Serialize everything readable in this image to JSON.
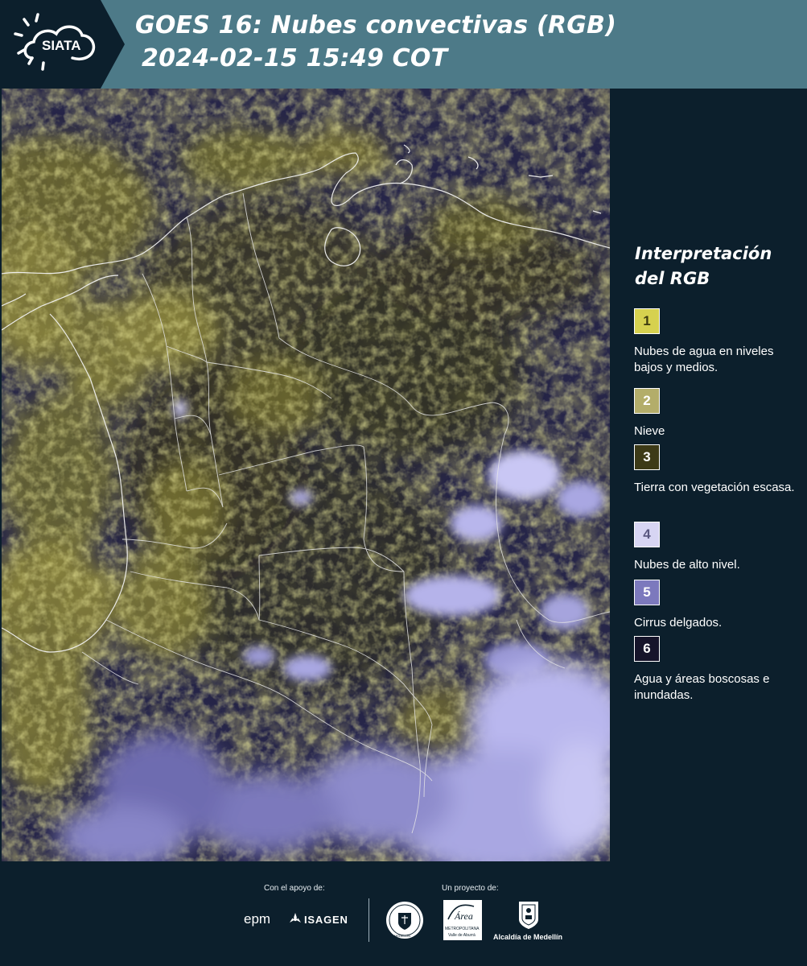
{
  "header": {
    "logo_text": "SIATA",
    "title_line1": "GOES 16: Nubes convectivas (RGB)",
    "title_line2": "2024-02-15 15:49 COT"
  },
  "legend": {
    "title": "Interpretación del RGB",
    "items": [
      {
        "number": "1",
        "label": "Nubes de agua en niveles bajos y medios.",
        "color": "#d6d14f",
        "number_color": "#3c3a10"
      },
      {
        "number": "2",
        "label": "Nieve",
        "color": "#b3ad6a",
        "number_color": "#ffffff"
      },
      {
        "number": "3",
        "label": "Tierra con vegetación escasa.",
        "color": "#3d3a17",
        "number_color": "#ffffff"
      },
      {
        "number": "4",
        "label": "Nubes de alto nivel.",
        "color": "#d7d5f3",
        "number_color": "#5a5880"
      },
      {
        "number": "5",
        "label": "Cirrus delgados.",
        "color": "#7c79bd",
        "number_color": "#ffffff"
      },
      {
        "number": "6",
        "label": "Agua y áreas boscosas e inundadas.",
        "color": "#16142a",
        "number_color": "#ffffff"
      }
    ]
  },
  "footer": {
    "support_label": "Con el apoyo de:",
    "project_label": "Un proyecto de:",
    "sponsor_epm": "epm",
    "sponsor_isagen": "ISAGEN",
    "area_metropolitana": "Área",
    "area_sub1": "METROPOLITANA",
    "area_sub2": "Valle de Aburrá",
    "alcaldia": "Alcaldía de Medellín",
    "seal_text": "MEDELLÍN"
  },
  "colors": {
    "header_bg": "#4d7a88",
    "page_bg": "#0c1f2c",
    "low_cloud_yellow": "#d6d14f",
    "high_cloud_lavender": "#c9c7f4"
  }
}
